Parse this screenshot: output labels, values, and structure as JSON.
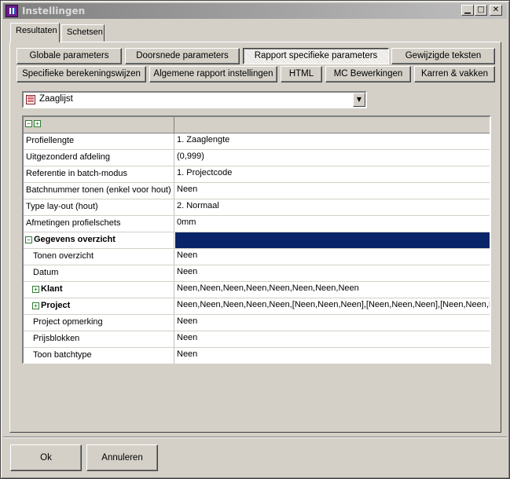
{
  "window": {
    "title": "Instellingen",
    "minimize": "▁",
    "maximize": "□",
    "close": "✕"
  },
  "tabs": [
    {
      "label": "Resultaten",
      "active": true
    },
    {
      "label": "Schetsen",
      "active": false
    }
  ],
  "buttons_row1": [
    {
      "label": "Globale parameters"
    },
    {
      "label": "Doorsnede parameters"
    },
    {
      "label": "Rapport specifieke parameters",
      "pressed": true
    },
    {
      "label": "Gewijzigde teksten"
    }
  ],
  "buttons_row2": [
    {
      "label": "Specifieke berekeningswijzen"
    },
    {
      "label": "Algemene rapport instellingen"
    },
    {
      "label": "HTML"
    },
    {
      "label": "MC Bewerkingen"
    },
    {
      "label": "Karren & vakken"
    }
  ],
  "report_select": {
    "value": "Zaaglijst",
    "arrow": "▼"
  },
  "grid": {
    "collapse_all": "−",
    "expand_all": "+",
    "rows": [
      {
        "label": "Profiellengte",
        "value": "1. Zaaglengte"
      },
      {
        "label": "Uitgezonderd afdeling",
        "value": "(0,999)"
      },
      {
        "label": "Referentie in batch-modus",
        "value": "1. Projectcode"
      },
      {
        "label": "Batchnummer tonen (enkel voor hout)",
        "value": "Neen"
      },
      {
        "label": "Type lay-out (hout)",
        "value": "2. Normaal"
      },
      {
        "label": "Afmetingen profielschets",
        "value": "0mm"
      },
      {
        "label": "Gegevens overzicht",
        "value": "",
        "expander": "−"
      },
      {
        "label": "Tonen overzicht",
        "value": "Neen"
      },
      {
        "label": "Datum",
        "value": "Neen"
      },
      {
        "label": "Klant",
        "value": "Neen,Neen,Neen,Neen,Neen,Neen,Neen,Neen",
        "expander": "+"
      },
      {
        "label": "Project",
        "value": "Neen,Neen,Neen,Neen,Neen,[Neen,Neen,Neen],[Neen,Neen,Neen],[Neen,Neen,Neen]",
        "expander": "+"
      },
      {
        "label": "Project opmerking",
        "value": "Neen"
      },
      {
        "label": "Prijsblokken",
        "value": "Neen"
      },
      {
        "label": "Toon batchtype",
        "value": "Neen"
      }
    ]
  },
  "footer": {
    "ok": "Ok",
    "cancel": "Annuleren"
  }
}
